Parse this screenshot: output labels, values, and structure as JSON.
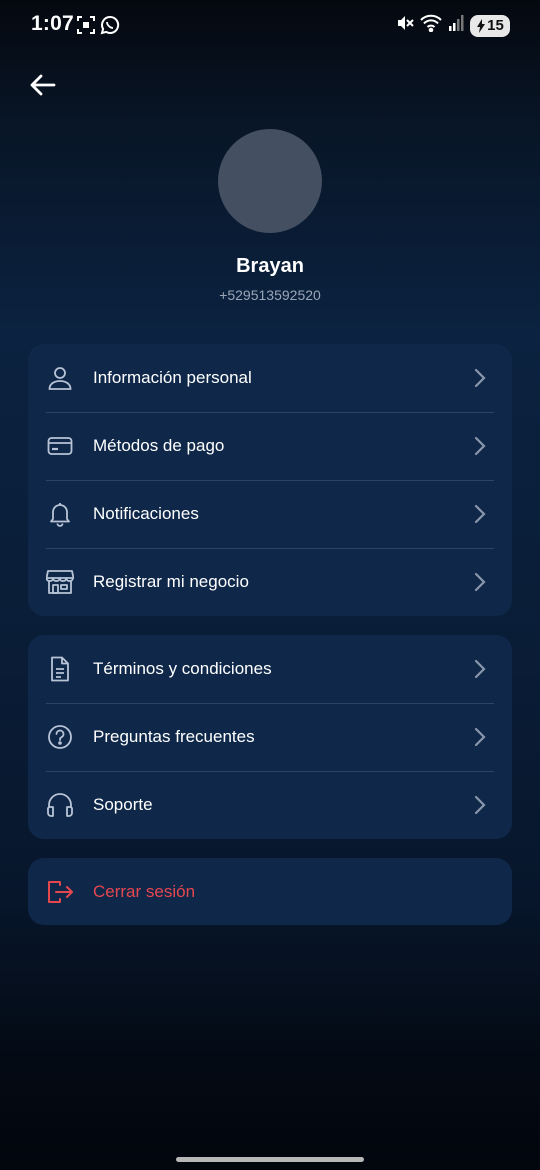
{
  "status_bar": {
    "time": "1:07",
    "battery_level": "15",
    "icons": [
      "screenshot-icon",
      "whatsapp-icon",
      "mute-icon",
      "wifi-icon",
      "signal-icon",
      "battery-icon"
    ]
  },
  "header": {
    "back_icon": "arrow-left-icon"
  },
  "profile": {
    "name": "Brayan",
    "phone": "+529513592520"
  },
  "menu_group_1": [
    {
      "label": "Información personal",
      "icon": "user-icon"
    },
    {
      "label": "Métodos de pago",
      "icon": "credit-card-icon"
    },
    {
      "label": "Notificaciones",
      "icon": "bell-icon"
    },
    {
      "label": "Registrar mi negocio",
      "icon": "store-icon"
    }
  ],
  "menu_group_2": [
    {
      "label": "Términos y condiciones",
      "icon": "document-icon"
    },
    {
      "label": "Preguntas frecuentes",
      "icon": "question-circle-icon"
    },
    {
      "label": "Soporte",
      "icon": "headset-icon"
    }
  ],
  "logout": {
    "label": "Cerrar sesión",
    "icon": "logout-icon"
  },
  "colors": {
    "card_background": "#0f284a",
    "divider": "#2a4468",
    "logout_accent": "#e5474f",
    "avatar_placeholder": "#444f61",
    "icon_stroke": "#b8c4d6"
  }
}
